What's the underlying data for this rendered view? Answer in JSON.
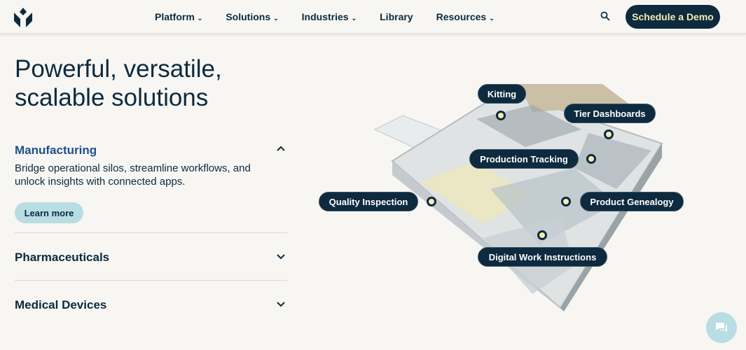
{
  "nav": {
    "items": [
      {
        "label": "Platform",
        "dropdown": true
      },
      {
        "label": "Solutions",
        "dropdown": true
      },
      {
        "label": "Industries",
        "dropdown": true
      },
      {
        "label": "Library",
        "dropdown": false
      },
      {
        "label": "Resources",
        "dropdown": true
      }
    ],
    "cta": "Schedule a Demo"
  },
  "hero": {
    "title_line1": "Powerful, versatile,",
    "title_line2": "scalable solutions"
  },
  "accordion": [
    {
      "title": "Manufacturing",
      "expanded": true,
      "description": "Bridge operational silos, streamline workflows, and unlock insights with connected apps.",
      "button": "Learn more"
    },
    {
      "title": "Pharmaceuticals",
      "expanded": false
    },
    {
      "title": "Medical Devices",
      "expanded": false
    }
  ],
  "hotspots": [
    "Kitting",
    "Tier Dashboards",
    "Production Tracking",
    "Quality Inspection",
    "Product Genealogy",
    "Digital Work Instructions"
  ],
  "colors": {
    "navy": "#0d2a3e",
    "accent": "#f3ecb0",
    "light_teal": "#b8dde2",
    "active": "#1f4f8a"
  }
}
